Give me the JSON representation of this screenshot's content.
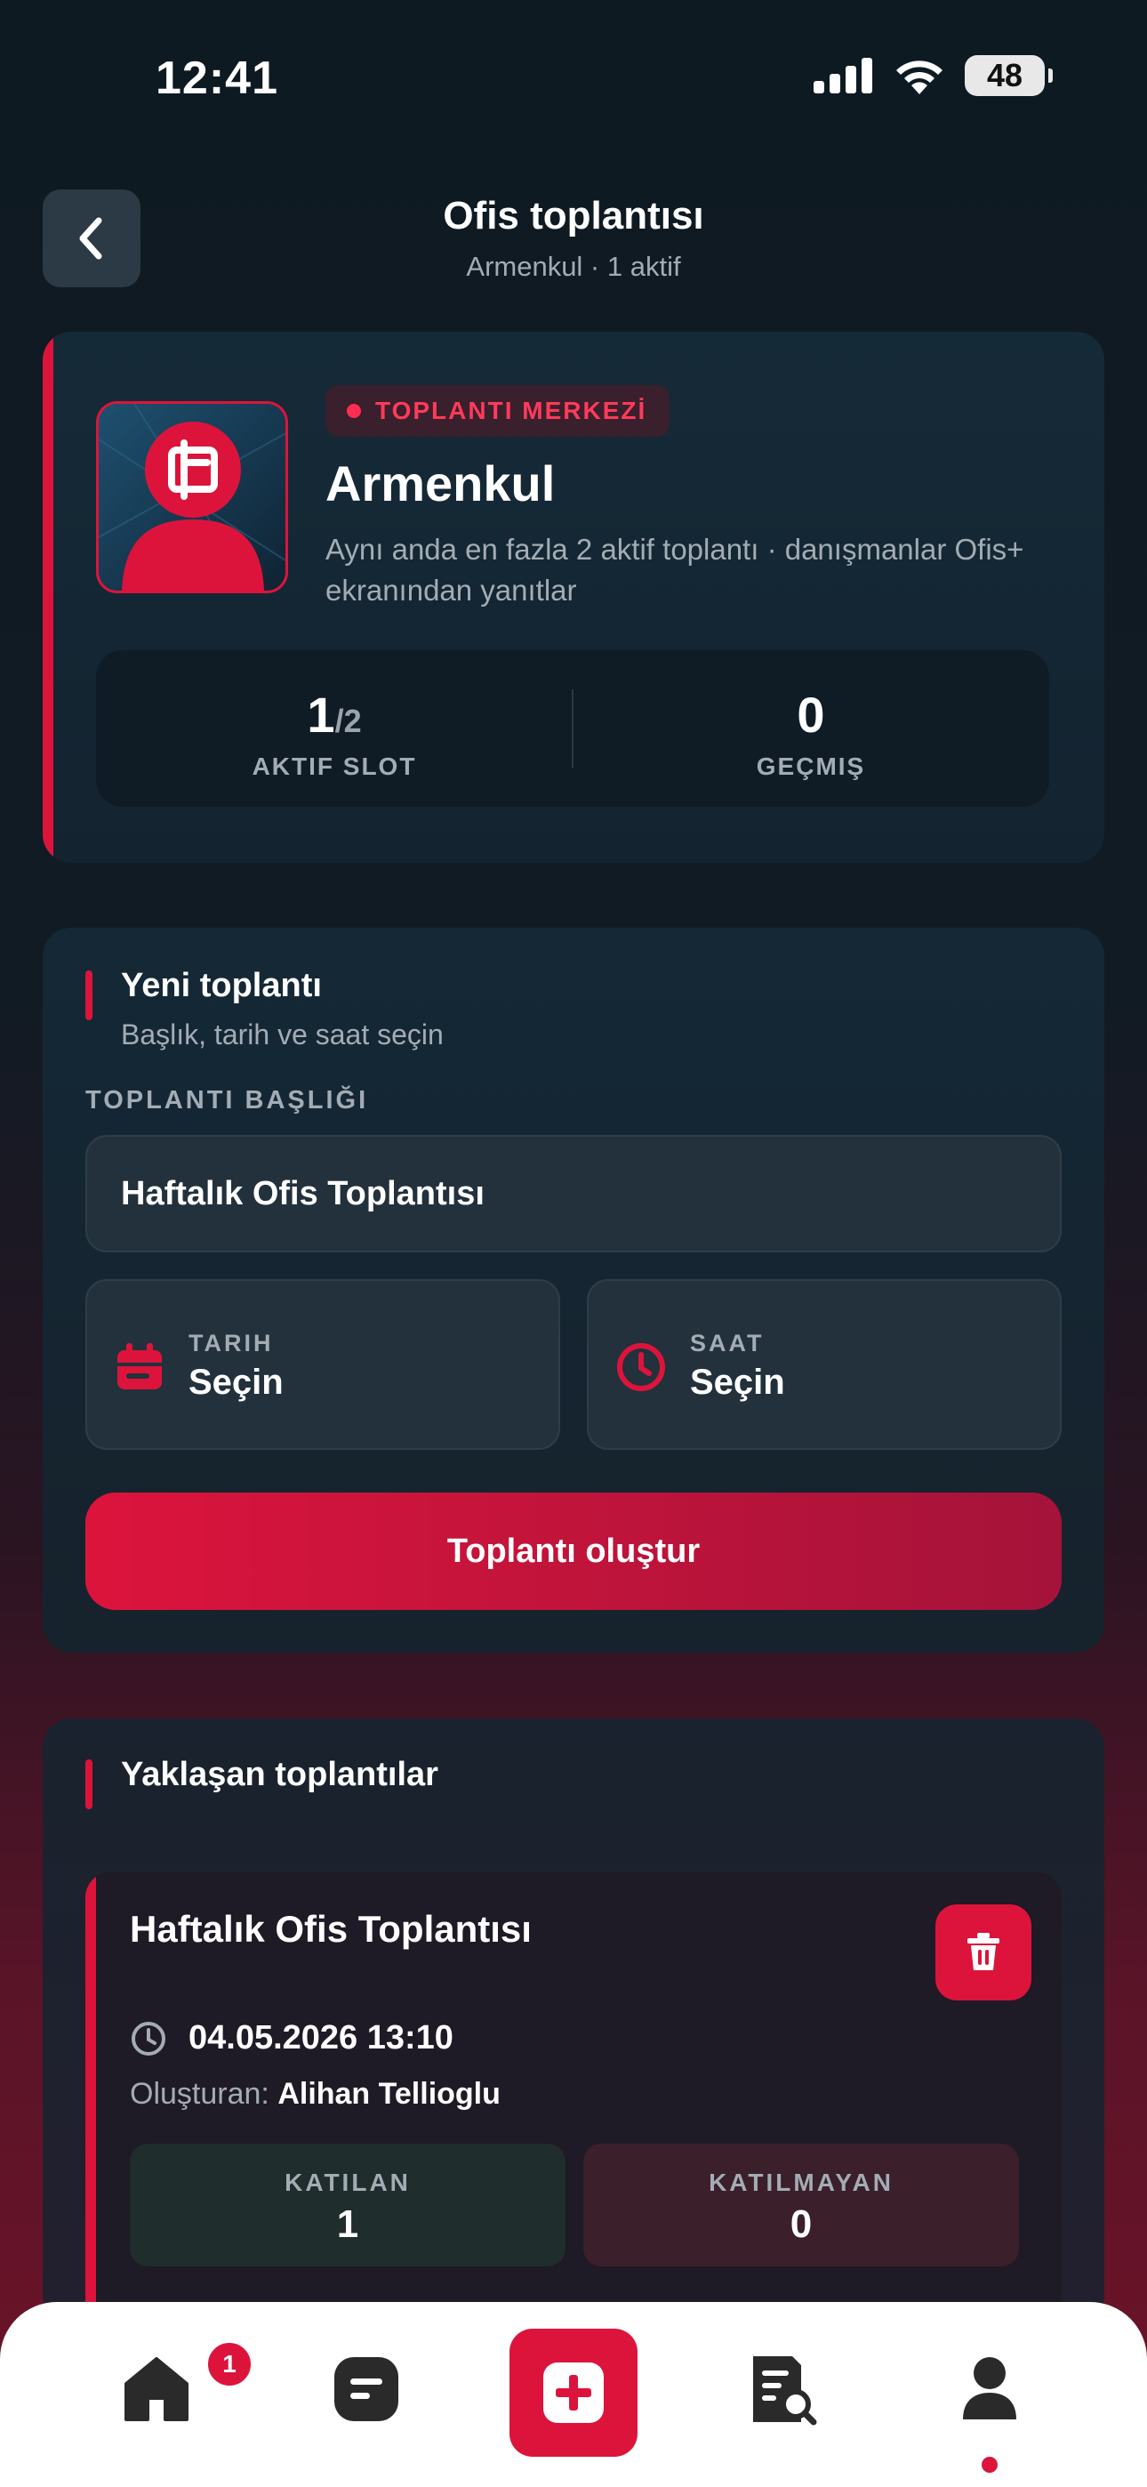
{
  "status_bar": {
    "time": "12:41",
    "battery": "48"
  },
  "header": {
    "title": "Ofis toplantısı",
    "subtitle": "Armenkul · 1 aktif"
  },
  "office_card": {
    "badge": "TOPLANTI MERKEZİ",
    "name": "Armenkul",
    "description": "Aynı anda en fazla 2 aktif toplantı · danışmanlar Ofis+ ekranından yanıtlar",
    "active_slot": {
      "value": "1",
      "max": "/2",
      "label": "AKTIF SLOT"
    },
    "past": {
      "value": "0",
      "label": "GEÇMIŞ"
    }
  },
  "new_meeting": {
    "title": "Yeni toplantı",
    "subtitle": "Başlık, tarih ve saat seçin",
    "title_label": "TOPLANTI BAŞLIĞI",
    "title_value": "Haftalık Ofis Toplantısı",
    "date": {
      "label": "TARIH",
      "value": "Seçin"
    },
    "time": {
      "label": "SAAT",
      "value": "Seçin"
    },
    "submit_label": "Toplantı oluştur"
  },
  "upcoming": {
    "title": "Yaklaşan toplantılar",
    "meetings": [
      {
        "title": "Haftalık Ofis Toplantısı",
        "datetime": "04.05.2026 13:10",
        "creator_label": "Oluşturan:",
        "creator": "Alihan Tellioglu",
        "attending": {
          "label": "KATILAN",
          "value": "1"
        },
        "not_attending": {
          "label": "KATILMAYAN",
          "value": "0"
        }
      }
    ]
  },
  "bottom_nav": {
    "items": [
      "home-icon",
      "chat-icon",
      "plus-icon",
      "document-search-icon",
      "profile-icon"
    ],
    "home_badge": "1",
    "active": "profile-icon"
  },
  "colors": {
    "accent": "#dc143c",
    "background": "#0e1a22",
    "card": "#14242f"
  }
}
